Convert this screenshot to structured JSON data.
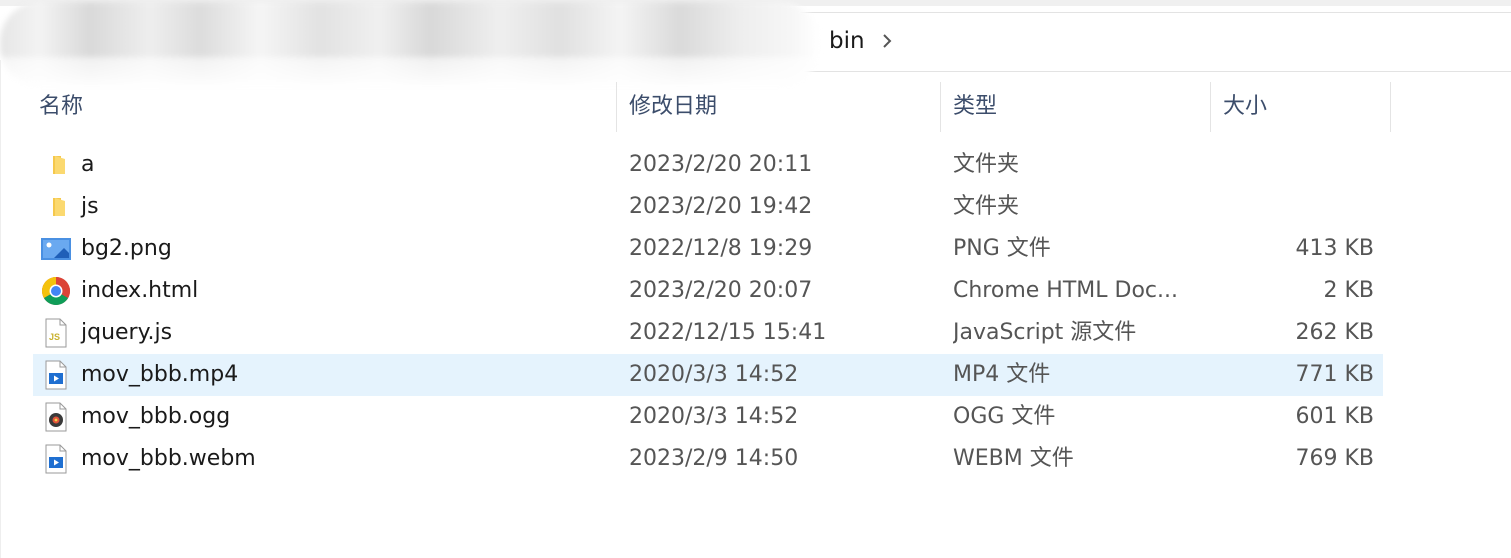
{
  "breadcrumb": {
    "current": "bin"
  },
  "columns": {
    "name": "名称",
    "modified": "修改日期",
    "type": "类型",
    "size": "大小"
  },
  "files": [
    {
      "name": "a",
      "modified": "2023/2/20 20:11",
      "type": "文件夹",
      "size": "",
      "icon": "folder-icon"
    },
    {
      "name": "js",
      "modified": "2023/2/20 19:42",
      "type": "文件夹",
      "size": "",
      "icon": "folder-icon"
    },
    {
      "name": "bg2.png",
      "modified": "2022/12/8 19:29",
      "type": "PNG 文件",
      "size": "413 KB",
      "icon": "image-file-icon"
    },
    {
      "name": "index.html",
      "modified": "2023/2/20 20:07",
      "type": "Chrome HTML Doc...",
      "size": "2 KB",
      "icon": "chrome-icon"
    },
    {
      "name": "jquery.js",
      "modified": "2022/12/15 15:41",
      "type": "JavaScript 源文件",
      "size": "262 KB",
      "icon": "js-file-icon"
    },
    {
      "name": "mov_bbb.mp4",
      "modified": "2020/3/3 14:52",
      "type": "MP4 文件",
      "size": "771 KB",
      "icon": "video-file-icon",
      "selected": true
    },
    {
      "name": "mov_bbb.ogg",
      "modified": "2020/3/3 14:52",
      "type": "OGG 文件",
      "size": "601 KB",
      "icon": "media-disc-file-icon"
    },
    {
      "name": "mov_bbb.webm",
      "modified": "2023/2/9 14:50",
      "type": "WEBM 文件",
      "size": "769 KB",
      "icon": "video-file-icon"
    }
  ],
  "colors": {
    "selected_row": "#e5f3fd",
    "header_text": "#3c4d6b",
    "folder": "#f5c84c"
  }
}
